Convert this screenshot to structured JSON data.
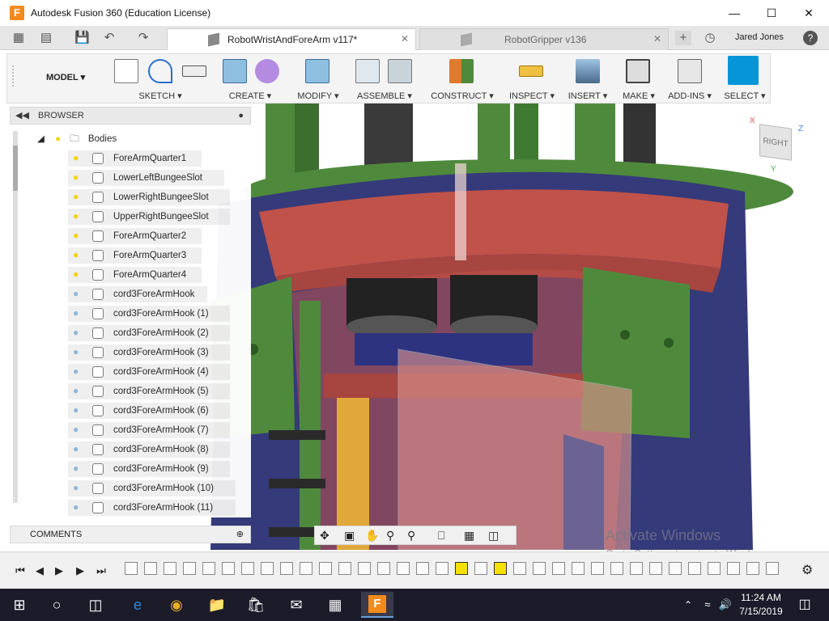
{
  "window": {
    "title": "Autodesk Fusion 360 (Education License)",
    "app_icon": "F"
  },
  "tabs": [
    {
      "label": "RobotWristAndForeArm v117*",
      "active": true
    },
    {
      "label": "RobotGripper v136",
      "active": false
    }
  ],
  "user": {
    "name": "Jared Jones"
  },
  "workspace": {
    "label": "MODEL"
  },
  "toolbar_groups": [
    "SKETCH",
    "CREATE",
    "MODIFY",
    "ASSEMBLE",
    "CONSTRUCT",
    "INSPECT",
    "INSERT",
    "MAKE",
    "ADD-INS",
    "SELECT"
  ],
  "browser": {
    "title": "BROWSER",
    "folder": "Bodies",
    "items": [
      {
        "label": "ForeArmQuarter1",
        "visible": true
      },
      {
        "label": "LowerLeftBungeeSlot",
        "visible": true
      },
      {
        "label": "LowerRightBungeeSlot",
        "visible": true
      },
      {
        "label": "UpperRightBungeeSlot",
        "visible": true
      },
      {
        "label": "ForeArmQuarter2",
        "visible": true
      },
      {
        "label": "ForeArmQuarter3",
        "visible": true
      },
      {
        "label": "ForeArmQuarter4",
        "visible": true
      },
      {
        "label": "cord3ForeArmHook",
        "visible": false
      },
      {
        "label": "cord3ForeArmHook (1)",
        "visible": false
      },
      {
        "label": "cord3ForeArmHook (2)",
        "visible": false
      },
      {
        "label": "cord3ForeArmHook (3)",
        "visible": false
      },
      {
        "label": "cord3ForeArmHook (4)",
        "visible": false
      },
      {
        "label": "cord3ForeArmHook (5)",
        "visible": false
      },
      {
        "label": "cord3ForeArmHook (6)",
        "visible": false
      },
      {
        "label": "cord3ForeArmHook (7)",
        "visible": false
      },
      {
        "label": "cord3ForeArmHook (8)",
        "visible": false
      },
      {
        "label": "cord3ForeArmHook (9)",
        "visible": false
      },
      {
        "label": "cord3ForeArmHook (10)",
        "visible": false
      },
      {
        "label": "cord3ForeArmHook (11)",
        "visible": false
      }
    ]
  },
  "comments": {
    "title": "COMMENTS"
  },
  "viewcube": {
    "face": "RIGHT",
    "x_axis": "X",
    "z_axis": "Z",
    "y_axis": "Y"
  },
  "watermark": {
    "line1": "Activate Windows",
    "line2": "Go to Settings to activate Windows."
  },
  "clock": {
    "time": "11:24 AM",
    "date": "7/15/2019"
  },
  "colors": {
    "accent": "#0696d7",
    "bulb_on": "#f2d200",
    "bulb_off": "#8cb4d8",
    "model_red": "#c0524a",
    "model_green": "#4f8a3c",
    "model_blue": "#353a7a",
    "model_yellow": "#e0a83a"
  }
}
